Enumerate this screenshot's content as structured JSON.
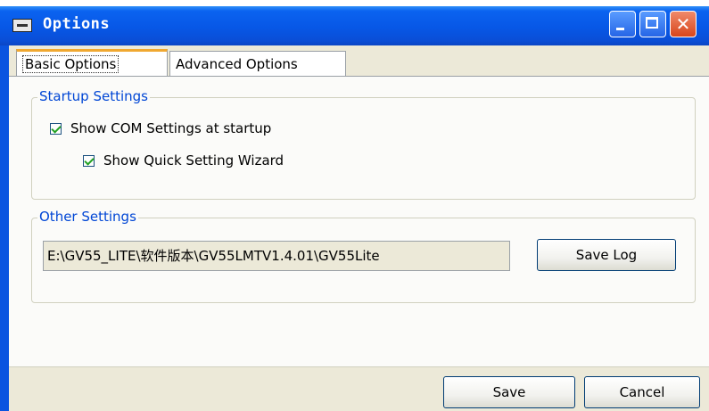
{
  "window": {
    "title": "Options"
  },
  "tabs": [
    {
      "label": "Basic Options",
      "selected": true
    },
    {
      "label": "Advanced Options",
      "selected": false
    }
  ],
  "startup_settings": {
    "legend": "Startup Settings",
    "show_com_settings": {
      "label": "Show COM Settings at startup",
      "checked": true
    },
    "show_quick_wizard": {
      "label": "Show Quick Setting Wizard",
      "checked": true
    }
  },
  "other_settings": {
    "legend": "Other Settings",
    "log_path": "E:\\GV55_LITE\\软件版本\\GV55LMTV1.4.01\\GV55Lite",
    "save_log_label": "Save Log"
  },
  "footer": {
    "save_label": "Save",
    "cancel_label": "Cancel"
  },
  "colors": {
    "titlebar": "#0757e6",
    "legend_text": "#0046d5",
    "selected_tab_accent": "#f0a830",
    "checkmark": "#21a121",
    "dialog_background": "#ece9d8"
  }
}
